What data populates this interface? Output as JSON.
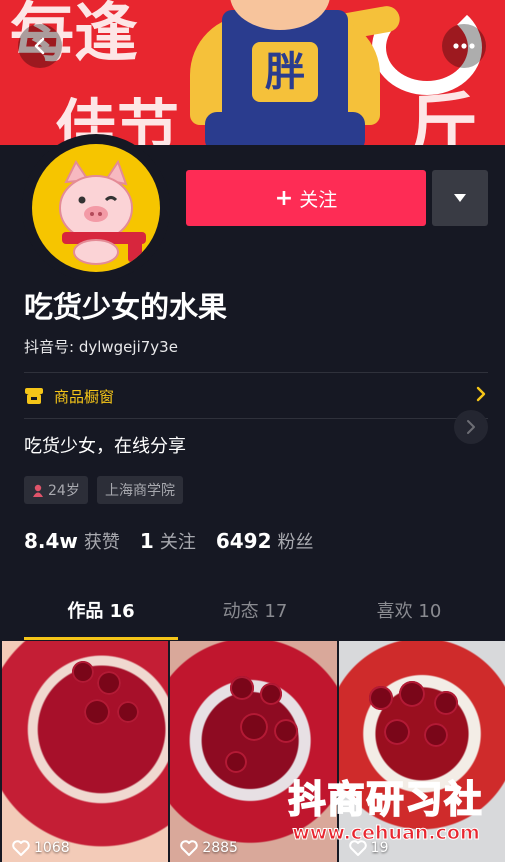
{
  "banner": {
    "text_top": "每逢",
    "text_bottom": "佳节",
    "text_right": "斤",
    "text_shirt": "胖"
  },
  "profile": {
    "follow_label": "关注",
    "nickname": "吃货少女的水果",
    "douyin_id": "抖音号: dylwgeji7y3e",
    "shop_window_label": "商品橱窗",
    "bio": "吃货少女，在线分享",
    "tags": {
      "age": "24岁",
      "school": "上海商学院"
    },
    "stats": {
      "likes_count": "8.4w",
      "likes_label": "获赞",
      "following_count": "1",
      "following_label": "关注",
      "followers_count": "6492",
      "followers_label": "粉丝"
    }
  },
  "tabs": [
    {
      "label": "作品 16",
      "active": true
    },
    {
      "label": "动态 17",
      "active": false
    },
    {
      "label": "喜欢 10",
      "active": false
    }
  ],
  "videos": [
    {
      "likes": "1068"
    },
    {
      "likes": "2885"
    },
    {
      "likes": "19"
    }
  ],
  "watermark": {
    "title": "抖商研习社",
    "url": "www.cehuan.com"
  },
  "colors": {
    "background": "#161823",
    "follow": "#fe2c55",
    "accent": "#f5c518",
    "banner": "#e8262f"
  },
  "icons": [
    "back-arrow-icon",
    "more-dots-icon",
    "plus-icon",
    "caret-down-icon",
    "shop-icon",
    "chevron-right-icon",
    "female-person-icon",
    "heart-icon"
  ]
}
